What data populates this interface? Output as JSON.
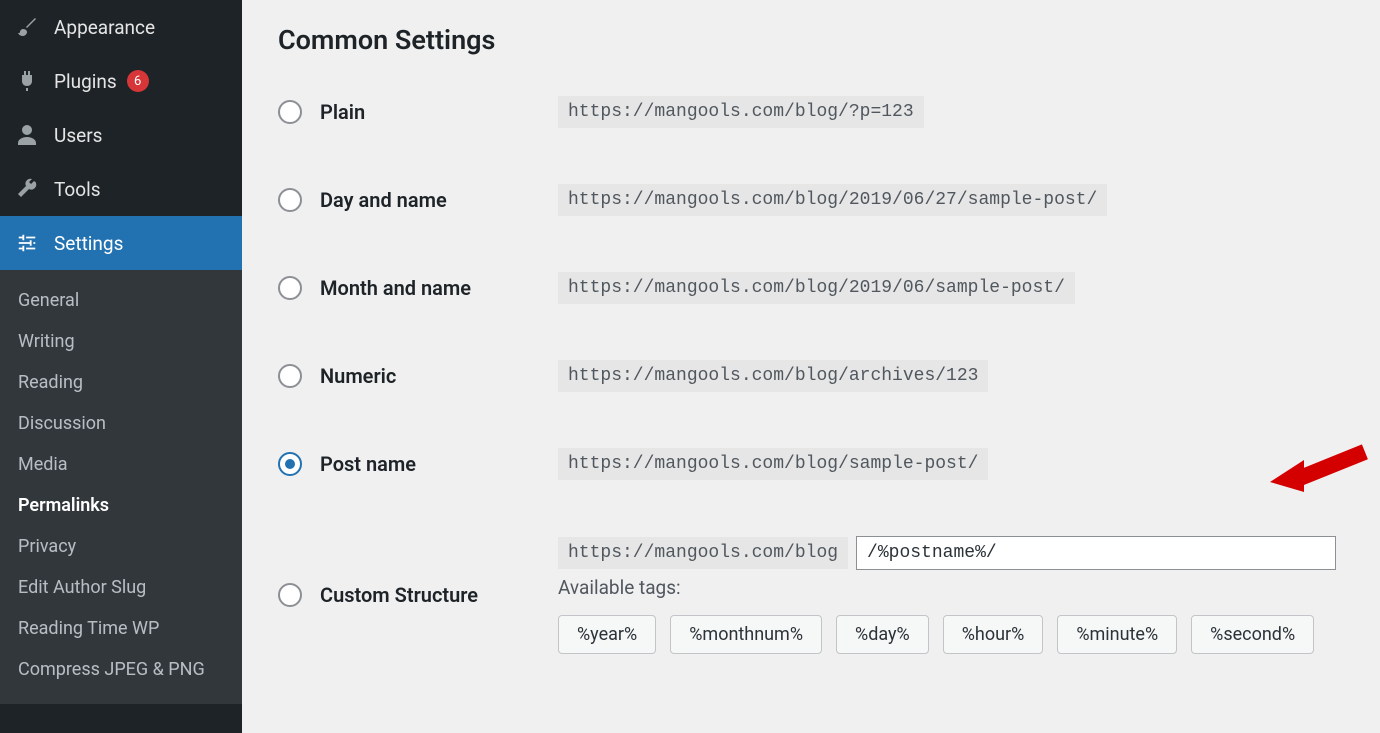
{
  "sidebar": {
    "primary": [
      {
        "id": "appearance",
        "label": "Appearance",
        "icon": "brush"
      },
      {
        "id": "plugins",
        "label": "Plugins",
        "icon": "plug",
        "badge": "6"
      },
      {
        "id": "users",
        "label": "Users",
        "icon": "user"
      },
      {
        "id": "tools",
        "label": "Tools",
        "icon": "wrench"
      },
      {
        "id": "settings",
        "label": "Settings",
        "icon": "sliders",
        "active": true
      }
    ],
    "settings_submenu": [
      "General",
      "Writing",
      "Reading",
      "Discussion",
      "Media",
      "Permalinks",
      "Privacy",
      "Edit Author Slug",
      "Reading Time WP",
      "Compress JPEG & PNG"
    ],
    "current_submenu": "Permalinks"
  },
  "page": {
    "section_title": "Common Settings",
    "options": [
      {
        "key": "plain",
        "label": "Plain",
        "example": "https://mangools.com/blog/?p=123"
      },
      {
        "key": "dayname",
        "label": "Day and name",
        "example": "https://mangools.com/blog/2019/06/27/sample-post/"
      },
      {
        "key": "monthname",
        "label": "Month and name",
        "example": "https://mangools.com/blog/2019/06/sample-post/"
      },
      {
        "key": "numeric",
        "label": "Numeric",
        "example": "https://mangools.com/blog/archives/123"
      },
      {
        "key": "postname",
        "label": "Post name",
        "example": "https://mangools.com/blog/sample-post/",
        "selected": true
      }
    ],
    "custom": {
      "label": "Custom Structure",
      "base": "https://mangools.com/blog",
      "value": "/%postname%/"
    },
    "tags_label": "Available tags:",
    "tags": [
      "%year%",
      "%monthnum%",
      "%day%",
      "%hour%",
      "%minute%",
      "%second%"
    ]
  }
}
